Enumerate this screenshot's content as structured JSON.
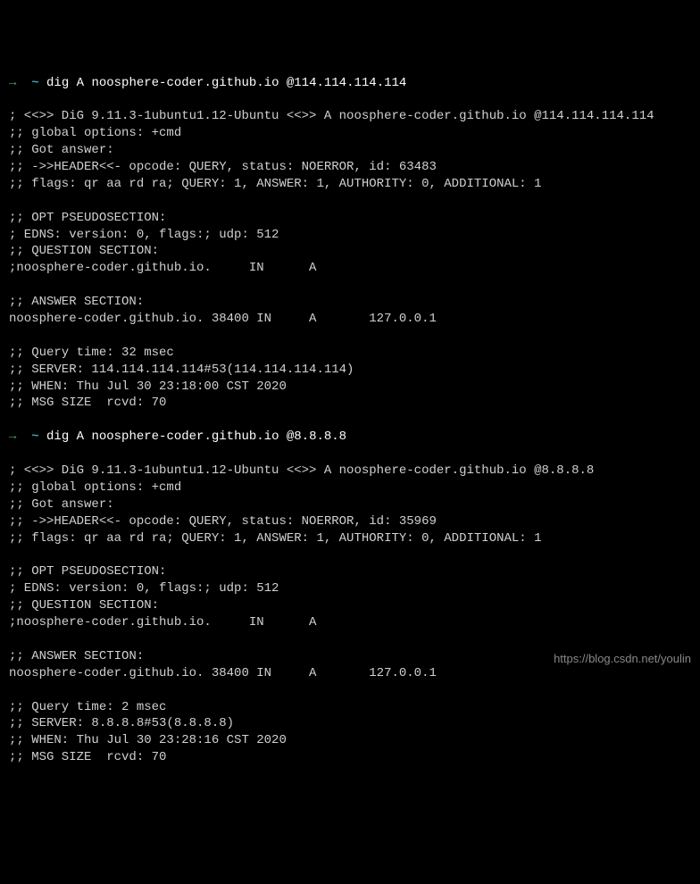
{
  "prompt1": {
    "arrow": "→",
    "tilde": "~",
    "command": "dig A noosphere-coder.github.io @114.114.114.114"
  },
  "output1": {
    "l1": "",
    "l2": "; <<>> DiG 9.11.3-1ubuntu1.12-Ubuntu <<>> A noosphere-coder.github.io @114.114.114.114",
    "l3": ";; global options: +cmd",
    "l4": ";; Got answer:",
    "l5": ";; ->>HEADER<<- opcode: QUERY, status: NOERROR, id: 63483",
    "l6": ";; flags: qr aa rd ra; QUERY: 1, ANSWER: 1, AUTHORITY: 0, ADDITIONAL: 1",
    "l7": "",
    "l8": ";; OPT PSEUDOSECTION:",
    "l9": "; EDNS: version: 0, flags:; udp: 512",
    "l10": ";; QUESTION SECTION:",
    "l11": ";noosphere-coder.github.io.     IN      A",
    "l12": "",
    "l13": ";; ANSWER SECTION:",
    "l14": "noosphere-coder.github.io. 38400 IN     A       127.0.0.1",
    "l15": "",
    "l16": ";; Query time: 32 msec",
    "l17": ";; SERVER: 114.114.114.114#53(114.114.114.114)",
    "l18": ";; WHEN: Thu Jul 30 23:18:00 CST 2020",
    "l19": ";; MSG SIZE  rcvd: 70",
    "l20": ""
  },
  "prompt2": {
    "arrow": "→",
    "tilde": "~",
    "command": "dig A noosphere-coder.github.io @8.8.8.8"
  },
  "output2": {
    "l1": "",
    "l2": "; <<>> DiG 9.11.3-1ubuntu1.12-Ubuntu <<>> A noosphere-coder.github.io @8.8.8.8",
    "l3": ";; global options: +cmd",
    "l4": ";; Got answer:",
    "l5": ";; ->>HEADER<<- opcode: QUERY, status: NOERROR, id: 35969",
    "l6": ";; flags: qr aa rd ra; QUERY: 1, ANSWER: 1, AUTHORITY: 0, ADDITIONAL: 1",
    "l7": "",
    "l8": ";; OPT PSEUDOSECTION:",
    "l9": "; EDNS: version: 0, flags:; udp: 512",
    "l10": ";; QUESTION SECTION:",
    "l11": ";noosphere-coder.github.io.     IN      A",
    "l12": "",
    "l13": ";; ANSWER SECTION:",
    "l14": "noosphere-coder.github.io. 38400 IN     A       127.0.0.1",
    "l15": "",
    "l16": ";; Query time: 2 msec",
    "l17": ";; SERVER: 8.8.8.8#53(8.8.8.8)",
    "l18": ";; WHEN: Thu Jul 30 23:28:16 CST 2020",
    "l19": ";; MSG SIZE  rcvd: 70"
  },
  "watermark": "https://blog.csdn.net/youlin"
}
